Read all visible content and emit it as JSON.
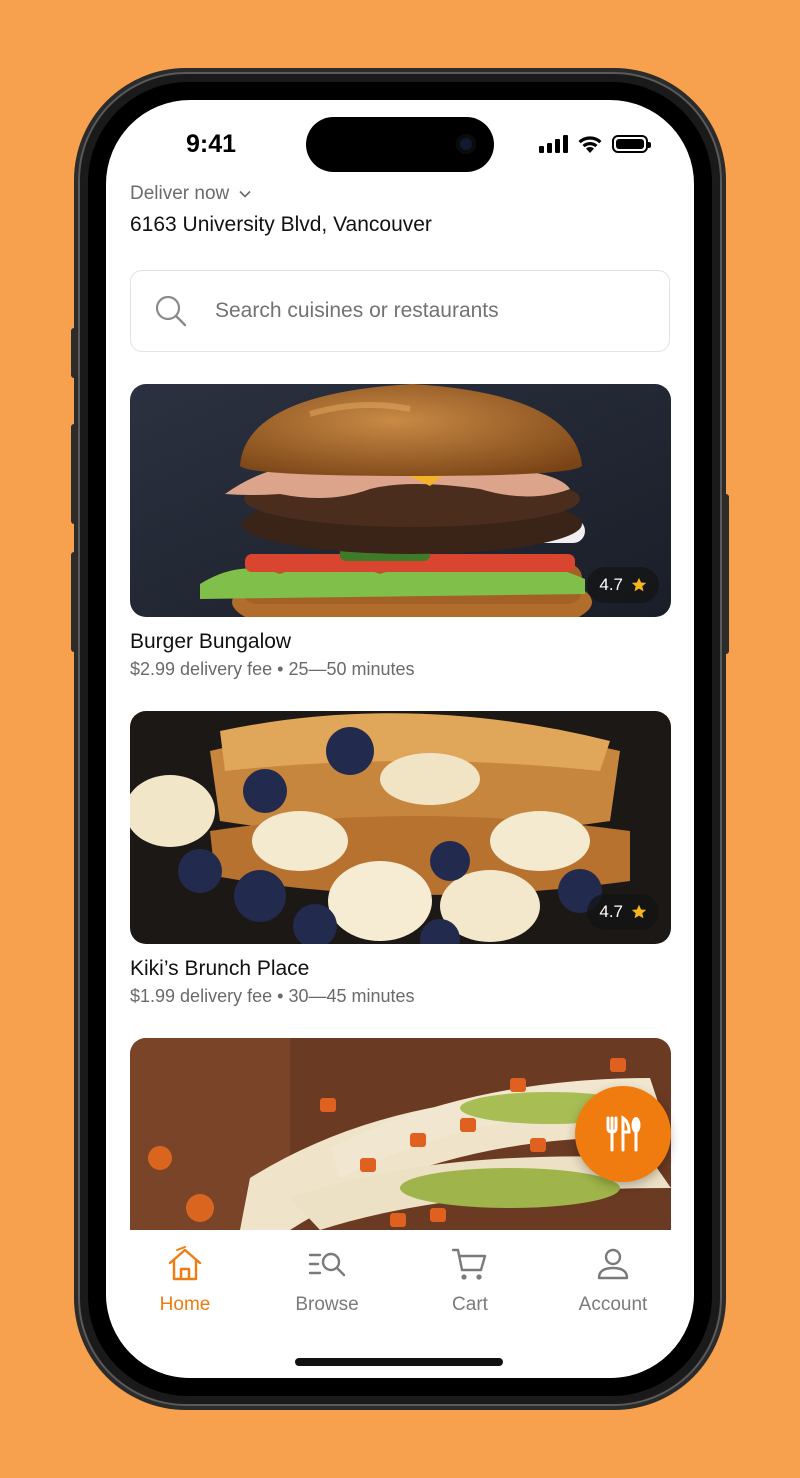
{
  "colors": {
    "background": "#F7A04E",
    "accent": "#F07C10"
  },
  "status_bar": {
    "time": "9:41",
    "icons": [
      "signal-icon",
      "wifi-icon",
      "battery-icon"
    ]
  },
  "location": {
    "mode_label": "Deliver now",
    "address": "6163 University Blvd, Vancouver"
  },
  "search": {
    "placeholder": "Search cuisines or restaurants"
  },
  "restaurants": [
    {
      "name": "Burger Bungalow",
      "delivery_fee": "$2.99 delivery fee",
      "separator": "•",
      "eta": "25—50 minutes",
      "rating": "4.7"
    },
    {
      "name": "Kiki’s Brunch Place",
      "delivery_fee": "$1.99 delivery fee",
      "separator": "•",
      "eta": "30—45 minutes",
      "rating": "4.7"
    },
    {
      "name": "",
      "delivery_fee": "",
      "eta": "",
      "rating": ""
    }
  ],
  "fab": {
    "icon": "utensils-icon"
  },
  "tabs": [
    {
      "label": "Home",
      "icon": "home-icon",
      "active": true
    },
    {
      "label": "Browse",
      "icon": "browse-icon",
      "active": false
    },
    {
      "label": "Cart",
      "icon": "cart-icon",
      "active": false
    },
    {
      "label": "Account",
      "icon": "account-icon",
      "active": false
    }
  ]
}
